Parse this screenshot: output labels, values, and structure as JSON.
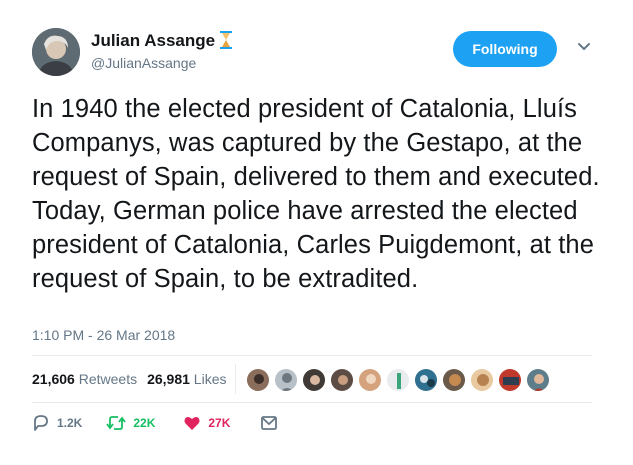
{
  "author": {
    "name": "Julian Assange",
    "handle": "@JulianAssange",
    "badge_icon": "hourglass-icon"
  },
  "follow_button": {
    "label": "Following",
    "color": "#1da1f2"
  },
  "tweet": {
    "text": "In 1940 the elected president of Catalonia, Lluís Companys, was captured by the Gestapo, at the request of Spain, delivered to them and executed. Today, German police have arrested the elected president of Catalonia, Carles Puigdemont, at the request of Spain, to be extradited.",
    "timestamp": "1:10 PM - 26 Mar 2018"
  },
  "stats": {
    "retweets_count": "21,606",
    "retweets_label": "Retweets",
    "likes_count": "26,981",
    "likes_label": "Likes"
  },
  "actions": {
    "reply_count": "1.2K",
    "retweet_count": "22K",
    "like_count": "27K",
    "reply_color": "#657786",
    "retweet_color": "#17bf63",
    "like_color": "#e0245e"
  }
}
